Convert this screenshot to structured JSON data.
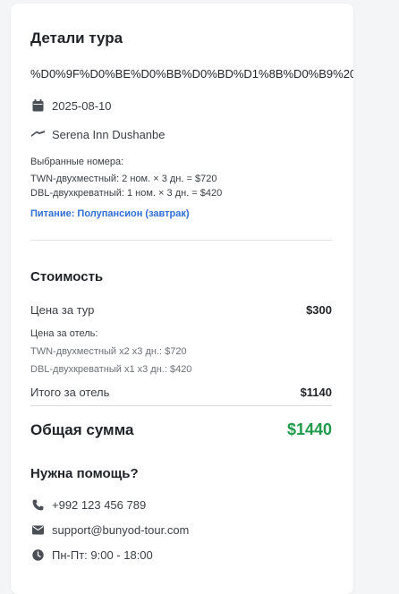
{
  "tour_details": {
    "title": "Детали тура",
    "encoded_name": "%D0%9F%D0%BE%D0%BB%D0%BD%D1%8B%D0%B9%20%D0%",
    "date": "2025-08-10",
    "hotel": "Serena Inn Dushanbe",
    "rooms_label": "Выбранные номера:",
    "rooms": [
      "TWN-двухместный: 2 ном. × 3 дн. = $720",
      "DBL-двухкреватный: 1 ном. × 3 дн. = $420"
    ],
    "meal": "Питание: Полупансион (завтрак)"
  },
  "cost": {
    "title": "Стоимость",
    "tour_price_label": "Цена за тур",
    "tour_price_value": "$300",
    "hotel_price_label": "Цена за отель:",
    "hotel_lines": [
      "TWN-двухместный x2 x3 дн.: $720",
      "DBL-двухкреватный x1 x3 дн.: $420"
    ],
    "hotel_total_label": "Итого за отель",
    "hotel_total_value": "$1140",
    "grand_total_label": "Общая сумма",
    "grand_total_value": "$1440",
    "grand_total_color": "#1e9a4a"
  },
  "help": {
    "title": "Нужна помощь?",
    "phone": "+992 123 456 789",
    "email": "support@bunyod-tour.com",
    "hours": "Пн-Пт: 9:00 - 18:00",
    "icons": [
      "phone-icon",
      "envelope-icon",
      "clock-icon"
    ]
  },
  "icons": {
    "date": "calendar-icon",
    "hotel": "bed-icon"
  },
  "colors": {
    "accent_link": "#2f6fd6"
  }
}
